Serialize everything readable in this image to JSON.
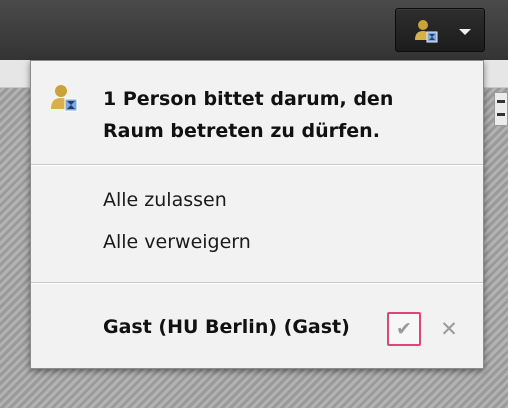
{
  "header": {
    "queue_button_icon": "user-queue-icon",
    "dropdown_icon": "caret-down-icon"
  },
  "popup": {
    "message_icon": "user-queue-icon",
    "message": "1 Person bittet darum, den\nRaum betreten zu dürfen.",
    "actions": [
      {
        "label": "Alle zulassen"
      },
      {
        "label": "Alle verweigern"
      }
    ],
    "guest": {
      "name": "Gast (HU Berlin) (Gast)",
      "accept_icon": "checkmark-icon",
      "accept_glyph": "✔",
      "deny_icon": "close-icon",
      "deny_glyph": "✕"
    }
  },
  "colors": {
    "accent_focus": "#e0457a"
  }
}
